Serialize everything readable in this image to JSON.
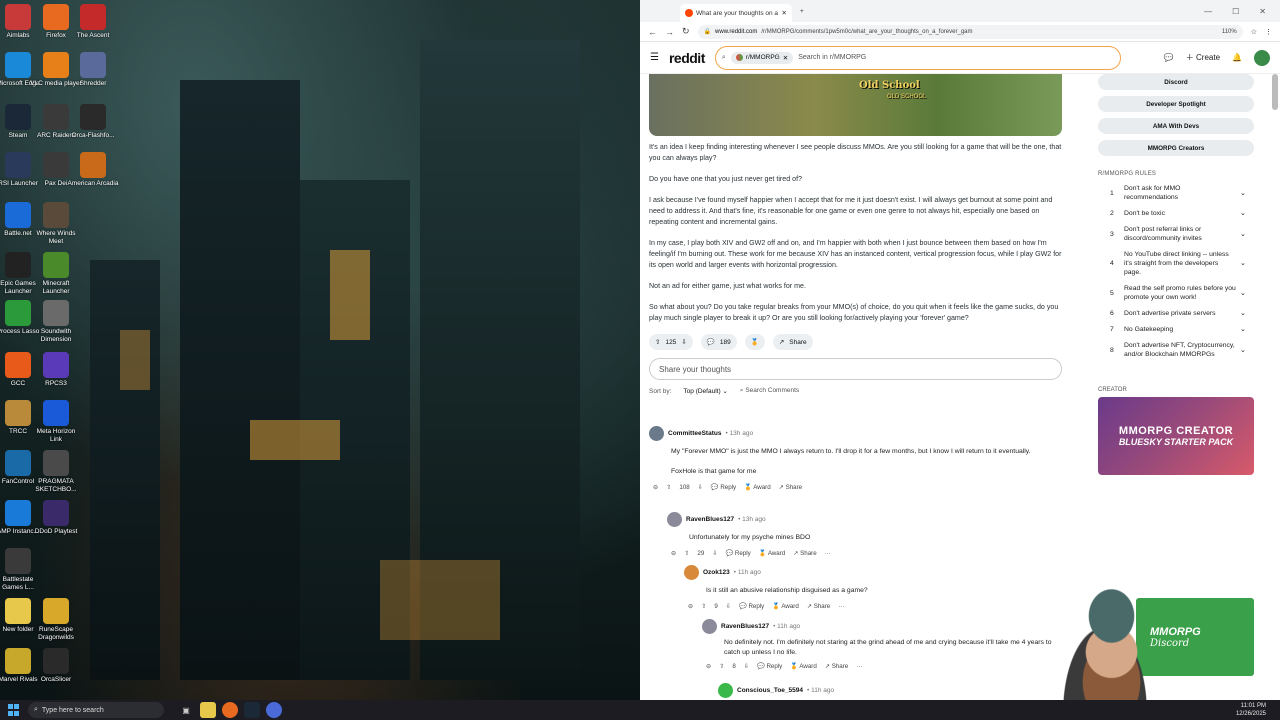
{
  "desktop": {
    "icons": [
      {
        "label": "Aimlabs",
        "color": "#c83a3a"
      },
      {
        "label": "Firefox",
        "color": "#e86a20"
      },
      {
        "label": "The Ascent",
        "color": "#c42a2a"
      },
      {
        "label": "Microsoft Edge",
        "color": "#1a8ad8"
      },
      {
        "label": "VLC media player",
        "color": "#e8801a"
      },
      {
        "label": "Shredder",
        "color": "#5a6a9a"
      },
      {
        "label": "Steam",
        "color": "#1b2838"
      },
      {
        "label": "ARC Raiders",
        "color": "#3a3a3a"
      },
      {
        "label": "Orca-Flashfo...",
        "color": "#2a2a2a"
      },
      {
        "label": "RSI Launcher",
        "color": "#2a3a5a"
      },
      {
        "label": "Pax Dei",
        "color": "#3a3a3a"
      },
      {
        "label": "American Arcadia",
        "color": "#c86a1a"
      },
      {
        "label": "Battle.net",
        "color": "#1a6ad8"
      },
      {
        "label": "Where Winds Meet",
        "color": "#5a4a3a"
      },
      {
        "label": "Epic Games Launcher",
        "color": "#222"
      },
      {
        "label": "Minecraft Launcher",
        "color": "#4a8a2a"
      },
      {
        "label": "Process Lasso",
        "color": "#2a9a3a"
      },
      {
        "label": "Soundwith Dimension",
        "color": "#6a6a6a"
      },
      {
        "label": "GCC",
        "color": "#e85a1a"
      },
      {
        "label": "RPCS3",
        "color": "#5a3ab8"
      },
      {
        "label": "TRCC",
        "color": "#b88a3a"
      },
      {
        "label": "Meta Horizon Link",
        "color": "#1a5ad8"
      },
      {
        "label": "FanControl",
        "color": "#1a6aa8"
      },
      {
        "label": "PRAGMATA SKETCHBO...",
        "color": "#4a4a4a"
      },
      {
        "label": "AMP Instanc...",
        "color": "#1a7ad8"
      },
      {
        "label": "DDoD Playtest",
        "color": "#3a2a6a"
      },
      {
        "label": "Battlestate Games L...",
        "color": "#3a3a3a"
      },
      {
        "label": "New folder",
        "color": "#e8c84a"
      },
      {
        "label": "RuneScape Dragonwilds",
        "color": "#d8a82a"
      },
      {
        "label": "Marvel Rivals",
        "color": "#c8a82a"
      },
      {
        "label": "OrcaSlicer",
        "color": "#2a2a2a"
      }
    ]
  },
  "taskbar": {
    "search_placeholder": "Type here to search",
    "time": "11:01 PM",
    "date": "12/26/2025"
  },
  "browser": {
    "tab_title": "What are your thoughts on a 'fo",
    "url_domain": "www.reddit.com",
    "url_path": "/r/MMORPG/comments/1pw5m0c/what_are_your_thoughts_on_a_forever_gam",
    "zoom": "110%"
  },
  "reddit": {
    "logo": "reddit",
    "search_chip": "r/MMORPG",
    "search_placeholder": "Search in r/MMORPG",
    "create_label": "Create",
    "post": {
      "paragraphs": [
        "It's an idea I keep finding interesting whenever I see people discuss MMOs. Are you still looking for a game that will be the one, that you can always play?",
        "Do you have one that you just never get tired of?",
        "I ask because I've found myself happier when I accept that for me it just doesn't exist. I will always get burnout at some point and need to address it. And that's fine, it's reasonable for one game or even one genre to not always hit, especially one based on repeating content and incremental gains.",
        "In my case, I play both XIV and GW2 off and on, and I'm happier with both when I just bounce between them based on how I'm feeling/if I'm burning out. These work for me because XIV has an instanced content, vertical progression focus, while I play GW2 for its open world and larger events with horizontal progression.",
        "Not an ad for either game, just what works for me.",
        "So what about you? Do you take regular breaks from your MMO(s) of choice, do you quit when it feels like the game sucks, do you play much single player to break it up? Or are you still looking for/actively playing your 'forever' game?"
      ],
      "votes": "125",
      "comments": "189",
      "share": "Share",
      "comment_placeholder": "Share your thoughts",
      "sort_label": "Sort by:",
      "sort_value": "Top (Default)",
      "search_comments": "Search Comments"
    },
    "comments": [
      {
        "user": "CommitteeStatus",
        "time": "13h ago",
        "body": "My \"Forever MMO\" is just the MMO I always return to. I'll drop it for a few months, but I know I will return to it eventually.",
        "body2": "FoxHole is that game for me",
        "votes": "108",
        "color": "#6a7a8a"
      },
      {
        "user": "RavenBlues127",
        "time": "13h ago",
        "body": "Unfortunately for my psyche mines BDO",
        "votes": "29",
        "color": "#8a8a9a"
      },
      {
        "user": "Ozok123",
        "time": "11h ago",
        "body": "Is it still an abusive relationship disguised as a game?",
        "votes": "9",
        "color": "#d88a3a"
      },
      {
        "user": "RavenBlues127",
        "time": "11h ago",
        "body": "No definitely not. I'm definitely not staring at the grind ahead of me and crying because it'll take me 4 years to catch up unless I no life.",
        "votes": "8",
        "color": "#8a8a9a"
      },
      {
        "user": "Conscious_Toe_5594",
        "time": "11h ago",
        "color": "#3ab84a"
      }
    ],
    "reply": "Reply",
    "award": "Award",
    "share": "Share",
    "sidebar": {
      "buttons": [
        "Discord",
        "Developer Spotlight",
        "AMA With Devs",
        "MMORPG Creators"
      ],
      "rules_heading": "R/MMORPG RULES",
      "rules": [
        "Don't ask for MMO recommendations",
        "Don't be toxic",
        "Don't post referral links or discord/community invites",
        "No YouTube direct linking -- unless it's straight from the developers page.",
        "Read the self promo rules before you promote your own work!",
        "Don't advertise private servers",
        "No Gatekeeping",
        "Don't advertise NFT, Cryptocurrency, and/or Blockchain MMORPGs"
      ],
      "creator_heading": "CREATOR",
      "creator_title": "MMORPG CREATOR",
      "creator_sub": "BLUESKY STARTER PACK",
      "discord_title": "MMORPG",
      "discord_sub": "Discord"
    }
  }
}
